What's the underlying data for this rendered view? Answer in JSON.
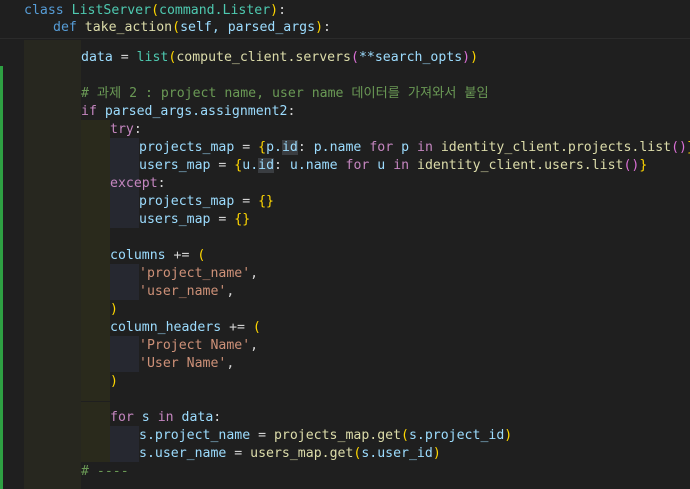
{
  "code": {
    "l0_class_kw": "class",
    "l0_class_name": "ListServer",
    "l0_base": "command.Lister",
    "l1_def_kw": "def",
    "l1_fn": "take_action",
    "l1_params": "self, parsed_args",
    "l3_data": "data",
    "l3_list": "list",
    "l3_fn": "compute_client.servers",
    "l3_arg": "**search_opts",
    "l5_comment": "# 과제 2 : project name, user name 데이터를 가져와서 붙임",
    "l6_if": "if",
    "l6_cond": "parsed_args.assignment2",
    "l7_try": "try",
    "l8_lhs": "projects_map",
    "l8_p": "p.",
    "l8_id": "id",
    "l8_val": "p.name",
    "l8_for": "for",
    "l8_var": "p",
    "l8_in": "in",
    "l8_iter": "identity_client.projects.list",
    "l9_lhs": "users_map",
    "l9_u": "u.",
    "l9_id": "id",
    "l9_val": "u.name",
    "l9_for": "for",
    "l9_var": "u",
    "l9_in": "in",
    "l9_iter": "identity_client.users.list",
    "l10_except": "except",
    "l11_lhs": "projects_map",
    "l12_lhs": "users_map",
    "l14_lhs": "columns",
    "l15_str": "'project_name'",
    "l16_str": "'user_name'",
    "l18_lhs": "column_headers",
    "l19_str": "'Project Name'",
    "l20_str": "'User Name'",
    "l23_for": "for",
    "l23_var": "s",
    "l23_in": "in",
    "l23_iter": "data",
    "l24_lhs": "s.project_name",
    "l24_fn": "projects_map.get",
    "l24_arg": "s.project_id",
    "l25_lhs": "s.user_name",
    "l25_fn": "users_map.get",
    "l25_arg": "s.user_id",
    "l26_comment": "# ----"
  },
  "colors": {
    "background": "#1f1f1f",
    "keyword": "#569cd6",
    "control": "#c586c0",
    "function": "#dcdcaa",
    "class": "#4ec9b0",
    "variable": "#9cdcfe",
    "string": "#ce9178",
    "comment": "#6a9955",
    "modified_gutter": "#2ea043"
  }
}
